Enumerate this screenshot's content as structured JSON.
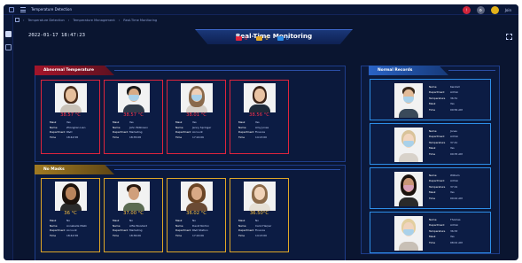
{
  "app": {
    "title": "Temperature Detection",
    "user_name": "Join"
  },
  "breadcrumb": [
    "Temperature Detection",
    "Temperature Management",
    "Real-Time Monitoring"
  ],
  "header": {
    "datetime": "2022-01-17 18:47:23",
    "title": "Real-Time Monitoring"
  },
  "stats": [
    {
      "icon": "abnormal-temp-icon",
      "color": "#e0243c",
      "count": "0"
    },
    {
      "icon": "no-mask-icon",
      "color": "#e0a726",
      "count": "0"
    },
    {
      "icon": "normal-icon",
      "color": "#2d8ee8",
      "count": "0"
    }
  ],
  "sections": {
    "abnormal": "Abnormal Temperature",
    "no_mask": "No Masks",
    "normal": "Normal Records"
  },
  "abnormal_cards": [
    {
      "temp": "38.57 °C",
      "fields": [
        [
          "Mask",
          "Yes"
        ],
        [
          "Name",
          "Zhonglian Lien"
        ],
        [
          "Department",
          "R&D"
        ],
        [
          "Time",
          "18:44:58"
        ]
      ]
    },
    {
      "temp": "38.57 °C",
      "fields": [
        [
          "Mask",
          "Yes"
        ],
        [
          "Name",
          "John Wilkinson"
        ],
        [
          "Department",
          "Marketing"
        ],
        [
          "Time",
          "18:35:08"
        ]
      ]
    },
    {
      "temp": "38.01 °C",
      "fields": [
        [
          "Mask",
          "Yes"
        ],
        [
          "Name",
          "Jenny Springer"
        ],
        [
          "Department",
          "Account"
        ],
        [
          "Time",
          "17:24:06"
        ]
      ]
    },
    {
      "temp": "38.56 °C",
      "fields": [
        [
          "Mask",
          "Yes"
        ],
        [
          "Name",
          "Amy Jones"
        ],
        [
          "Department",
          "Finance"
        ],
        [
          "Time",
          "14:13:00"
        ]
      ]
    }
  ],
  "nomask_cards": [
    {
      "temp": "36 °C",
      "fields": [
        [
          "Mask",
          "No"
        ],
        [
          "Name",
          "Annabelle Malik"
        ],
        [
          "Department",
          "Account"
        ],
        [
          "Time",
          "18:44:58"
        ]
      ]
    },
    {
      "temp": "37.00 °C",
      "fields": [
        [
          "Mask",
          "No"
        ],
        [
          "Name",
          "Alfie Woodard"
        ],
        [
          "Department",
          "Marketing"
        ],
        [
          "Time",
          "18:36:06"
        ]
      ]
    },
    {
      "temp": "36.02 °C",
      "fields": [
        [
          "Mask",
          "No"
        ],
        [
          "Name",
          "David Norton"
        ],
        [
          "Department",
          "R&D Station"
        ],
        [
          "Time",
          "17:24:06"
        ]
      ]
    },
    {
      "temp": "36.50°C",
      "fields": [
        [
          "Mask",
          "No"
        ],
        [
          "Name",
          "Carol Harper"
        ],
        [
          "Department",
          "Finance"
        ],
        [
          "Time",
          "14:13:00"
        ]
      ]
    }
  ],
  "normal_cards": [
    {
      "fields": [
        [
          "Name",
          "Kendall"
        ],
        [
          "Department",
          "Admin"
        ],
        [
          "Temperature",
          "36.51"
        ],
        [
          "Mask",
          "Yes"
        ],
        [
          "Time",
          "09:56 AM"
        ]
      ]
    },
    {
      "fields": [
        [
          "Name",
          "Jones"
        ],
        [
          "Department",
          "Admin"
        ],
        [
          "Temperature",
          "37.41"
        ],
        [
          "Mask",
          "Yes"
        ],
        [
          "Time",
          "09:35 AM"
        ]
      ]
    },
    {
      "fields": [
        [
          "Name",
          "William"
        ],
        [
          "Department",
          "Admin"
        ],
        [
          "Temperature",
          "37.01"
        ],
        [
          "Mask",
          "Yes"
        ],
        [
          "Time",
          "09:44 AM"
        ]
      ]
    },
    {
      "fields": [
        [
          "Name",
          "Thomas"
        ],
        [
          "Department",
          "Admin"
        ],
        [
          "Temperature",
          "36.53"
        ],
        [
          "Mask",
          "Yes"
        ],
        [
          "Time",
          "08:01 AM"
        ]
      ]
    }
  ]
}
